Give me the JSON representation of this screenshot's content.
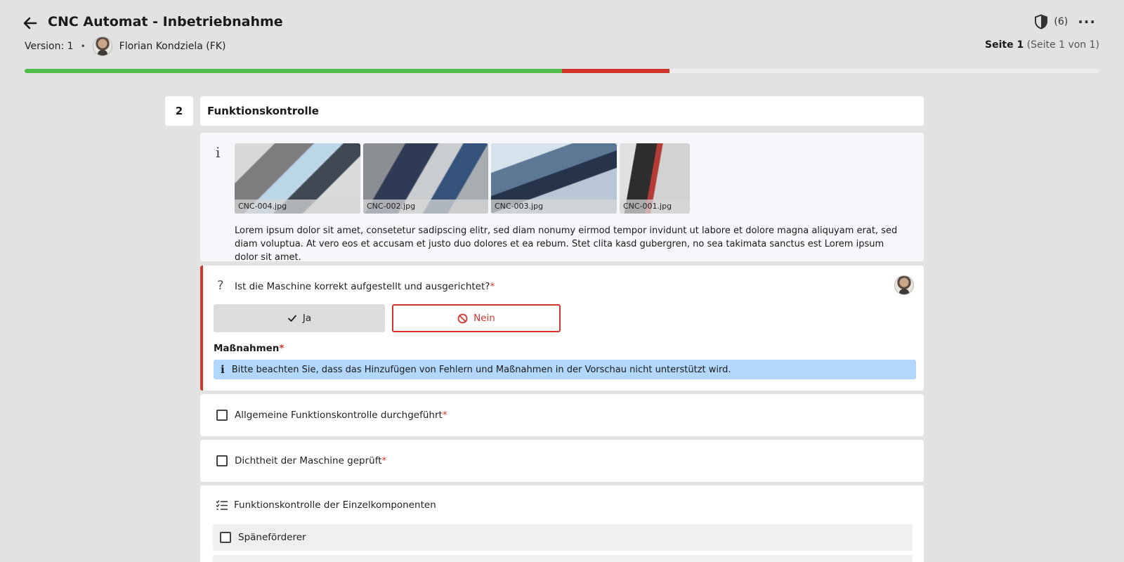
{
  "header": {
    "title": "CNC Automat - Inbetriebnahme",
    "version": "Version: 1",
    "separator": "•",
    "author": "Florian Kondziela (FK)",
    "shield_count": "(6)",
    "more": "···",
    "page_label": "Seite 1",
    "page_sub": "(Seite 1 von 1)"
  },
  "progress": {
    "ok_fraction": 0.5,
    "fail_fraction": 0.1,
    "colors": {
      "ok": "#4cbb47",
      "fail": "#d2352b",
      "rest": "#eeeeee"
    }
  },
  "section": {
    "number": "2",
    "title": "Funktionskontrolle"
  },
  "info": {
    "images": [
      {
        "caption": "CNC-004.jpg"
      },
      {
        "caption": "CNC-002.jpg"
      },
      {
        "caption": "CNC-003.jpg"
      },
      {
        "caption": "CNC-001.jpg"
      }
    ],
    "text": "Lorem ipsum dolor sit amet, consetetur sadipscing elitr, sed diam nonumy eirmod tempor invidunt ut labore et dolore magna aliquyam erat, sed diam voluptua. At vero eos et accusam et justo duo dolores et ea rebum. Stet clita kasd gubergren, no sea takimata sanctus est Lorem ipsum dolor sit amet."
  },
  "question": {
    "text": "Ist die Maschine korrekt aufgestellt und ausgerichtet?",
    "required_mark": "*",
    "yes_label": "Ja",
    "no_label": "Nein",
    "measures_label": "Maßnahmen",
    "notice": "Bitte beachten Sie, dass das Hinzufügen von Fehlern und Maßnahmen in der Vorschau nicht unterstützt wird."
  },
  "checks": [
    {
      "label": "Allgemeine Funktionskontrolle durchgeführt",
      "required_mark": "*"
    },
    {
      "label": "Dichtheit der Maschine geprüft",
      "required_mark": "*"
    }
  ],
  "checklist": {
    "title": "Funktionskontrolle der Einzelkomponenten",
    "items": [
      {
        "label": "Späneförderer"
      },
      {
        "label": ""
      }
    ]
  },
  "icons": {
    "back": "arrow-left-icon",
    "shield": "shield-icon",
    "info": "info-icon",
    "question": "question-mark-icon",
    "check": "check-icon",
    "forbidden": "forbidden-icon",
    "checklist": "checklist-icon"
  }
}
